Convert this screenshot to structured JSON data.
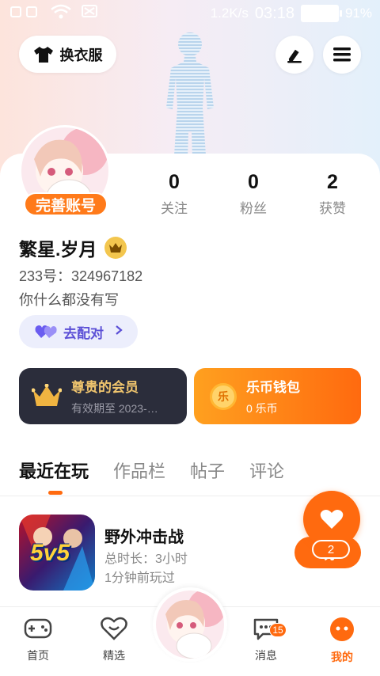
{
  "status_bar": {
    "network_speed": "1.2K/s",
    "time": "03:18",
    "battery": "91%"
  },
  "header": {
    "outfit_label": "换衣服"
  },
  "profile": {
    "complete_label": "完善账号",
    "stats": [
      {
        "value": "0",
        "label": "关注"
      },
      {
        "value": "0",
        "label": "粉丝"
      },
      {
        "value": "2",
        "label": "获赞"
      }
    ],
    "username": "繁星.岁月",
    "uid": "233号：324967182",
    "bio": "你什么都没有写",
    "match_label": "去配对"
  },
  "vip_card": {
    "title": "尊贵的会员",
    "subtitle": "有效期至 2023-…"
  },
  "wallet_card": {
    "title": "乐币钱包",
    "subtitle": "0 乐币",
    "coin_glyph": "乐"
  },
  "tabs": [
    "最近在玩",
    "作品栏",
    "帖子",
    "评论"
  ],
  "recent_games": [
    {
      "title": "野外冲击战",
      "playtime": "总时长：3小时",
      "last_played": "1分钟前玩过",
      "icon_text": "5v5",
      "action_label": "玩"
    }
  ],
  "like_fab": {
    "count": "2"
  },
  "bottom_nav": {
    "items": [
      {
        "label": "首页",
        "icon": "gamepad-icon"
      },
      {
        "label": "精选",
        "icon": "heart-chat-icon"
      },
      {
        "label": "消息",
        "icon": "message-icon",
        "badge": "15"
      },
      {
        "label": "我的",
        "icon": "profile-face-icon"
      }
    ]
  },
  "colors": {
    "accent": "#ff6a0f",
    "vip_gold": "#f0c56e",
    "match_purple": "#5b4fd6"
  }
}
